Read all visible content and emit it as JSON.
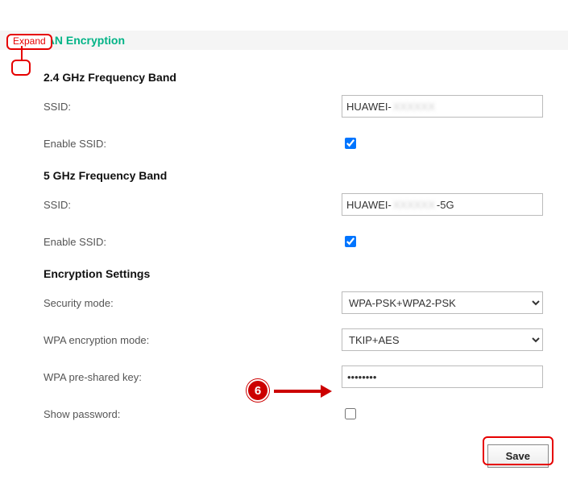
{
  "annotations": {
    "expand_label": "Expand",
    "step_number": "6"
  },
  "section": {
    "title": "WLAN Encryption"
  },
  "band24": {
    "heading": "2.4 GHz Frequency Band",
    "ssid_label": "SSID:",
    "ssid_prefix": "HUAWEI-",
    "ssid_obscured": "XXXXXX",
    "ssid_suffix": "",
    "enable_label": "Enable SSID:",
    "enable_checked": true
  },
  "band5": {
    "heading": "5 GHz Frequency Band",
    "ssid_label": "SSID:",
    "ssid_prefix": "HUAWEI-",
    "ssid_obscured": "XXXXXX",
    "ssid_suffix": "-5G",
    "enable_label": "Enable SSID:",
    "enable_checked": true
  },
  "enc": {
    "heading": "Encryption Settings",
    "security_mode_label": "Security mode:",
    "security_mode_value": "WPA-PSK+WPA2-PSK",
    "wpa_mode_label": "WPA encryption mode:",
    "wpa_mode_value": "TKIP+AES",
    "psk_label": "WPA pre-shared key:",
    "psk_value": "••••••••",
    "show_pw_label": "Show password:",
    "show_pw_checked": false
  },
  "actions": {
    "save_label": "Save"
  }
}
